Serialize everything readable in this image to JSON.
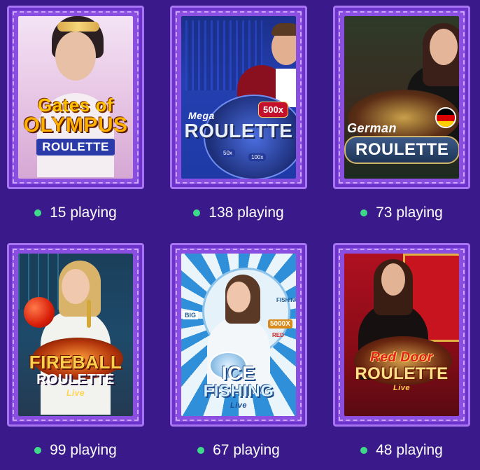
{
  "accent_live": "#3fd98a",
  "games": [
    {
      "logo_top": "Gates of",
      "logo_main": "OLYMPUS",
      "logo_sub": "ROULETTE",
      "players": "15 playing"
    },
    {
      "logo_top": "Mega",
      "logo_main": "ROULETTE",
      "logo_sub": "",
      "badge": "500x",
      "wheel_labels": [
        "50x",
        "100x"
      ],
      "players": "138 playing"
    },
    {
      "logo_top": "German",
      "logo_main": "ROULETTE",
      "logo_sub": "",
      "players": "73 playing"
    },
    {
      "logo_top": "",
      "logo_main": "FIREBALL",
      "logo_sub": "ROULETTE",
      "logo_tag": "Live",
      "players": "99 playing"
    },
    {
      "logo_top": "",
      "logo_main": "ICE",
      "logo_sub": "FISHING",
      "logo_tag": "Live",
      "wheel_labels": [
        "BIG",
        "FISHING",
        "5000X",
        "RED"
      ],
      "players": "67 playing"
    },
    {
      "logo_top": "Red Door",
      "logo_main": "ROULETTE",
      "logo_sub": "",
      "logo_tag": "Live",
      "players": "48 playing"
    }
  ]
}
